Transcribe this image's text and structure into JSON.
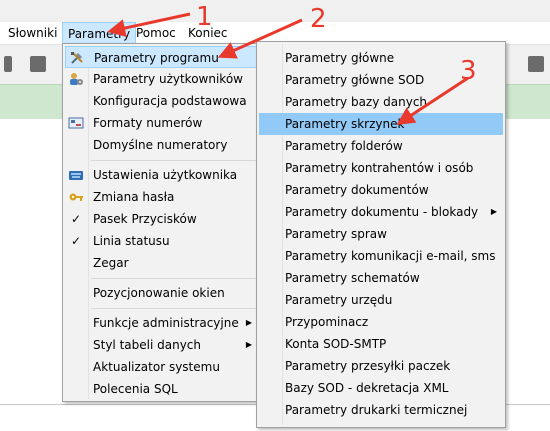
{
  "menubar": {
    "items": [
      {
        "label": "Słowniki"
      },
      {
        "label": "Parametry"
      },
      {
        "label": "Pomoc"
      },
      {
        "label": "Koniec"
      }
    ]
  },
  "menu_parametry": {
    "items": [
      {
        "label": "Parametry programu",
        "icon": "tools-icon",
        "submenu": false
      },
      {
        "label": "Parametry użytkowników",
        "icon": "users-gear-icon"
      },
      {
        "label": "Konfiguracja podstawowa"
      },
      {
        "label": "Formaty numerów",
        "icon": "numbering-icon"
      },
      {
        "label": "Domyślne numeratory"
      },
      {
        "label": "Ustawienia użytkownika",
        "icon": "keyboard-icon"
      },
      {
        "label": "Zmiana hasła",
        "icon": "key-icon"
      },
      {
        "label": "Pasek Przycisków",
        "checked": true
      },
      {
        "label": "Linia statusu",
        "checked": true
      },
      {
        "label": "Zegar"
      },
      {
        "label": "Pozycjonowanie okien"
      },
      {
        "label": "Funkcje administracyjne",
        "submenu": true
      },
      {
        "label": "Styl tabeli danych",
        "submenu": true
      },
      {
        "label": "Aktualizator systemu"
      },
      {
        "label": "Polecenia SQL"
      }
    ]
  },
  "menu_programu": {
    "items": [
      {
        "label": "Parametry główne"
      },
      {
        "label": "Parametry główne SOD"
      },
      {
        "label": "Parametry bazy danych"
      },
      {
        "label": "Parametry skrzynek"
      },
      {
        "label": "Parametry folderów"
      },
      {
        "label": "Parametry kontrahentów i osób"
      },
      {
        "label": "Parametry dokumentów"
      },
      {
        "label": "Parametry dokumentu - blokady",
        "submenu": true
      },
      {
        "label": "Parametry spraw"
      },
      {
        "label": "Parametry komunikacji e-mail, sms"
      },
      {
        "label": "Parametry schematów"
      },
      {
        "label": "Parametry urzędu"
      },
      {
        "label": "Przypominacz"
      },
      {
        "label": "Konta SOD-SMTP"
      },
      {
        "label": "Parametry przesyłki paczek"
      },
      {
        "label": "Bazy SOD - dekretacja XML"
      },
      {
        "label": "Parametry drukarki termicznej"
      }
    ]
  },
  "annotations": {
    "step1": "1",
    "step2": "2",
    "step3": "3",
    "color": "#e8392c"
  },
  "colors": {
    "highlight": "#91c9f7",
    "menubar_active": "#cce8ff",
    "greenbar": "#cfe6cf"
  }
}
